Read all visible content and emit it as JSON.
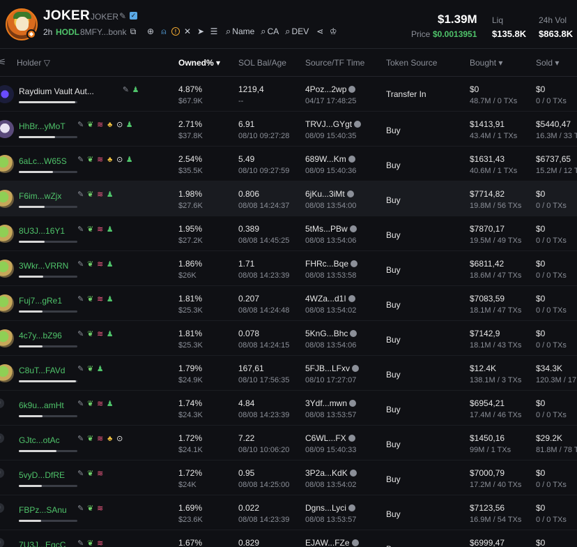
{
  "token": {
    "name": "JOKER",
    "symbol": "JOKER",
    "age": "2h",
    "hodl_label": "HODL",
    "ca_short": "8MFY...bonk",
    "search_name": "Name",
    "search_ca": "CA",
    "search_dev": "DEV"
  },
  "stats": {
    "market_cap": "$1.39M",
    "price_label": "Price",
    "price": "$0.0013951",
    "liq_label": "Liq",
    "liq": "$135.8K",
    "vol_label": "24h Vol",
    "vol": "$863.8K"
  },
  "columns": {
    "holder": "Holder",
    "owned": "Owned% ▾",
    "sol_bal": "SOL Bal/Age",
    "source_time": "Source/TF Time",
    "token_source": "Token Source",
    "bought": "Bought ▾",
    "sold": "Sold ▾"
  },
  "colors": {
    "accent_green": "#4fc36a",
    "background": "#0f1014",
    "muted": "#8b8f98"
  },
  "rows": [
    {
      "name": "Raydium Vault Aut...",
      "name_color": "white",
      "tags": [
        "person"
      ],
      "bar": 0.97,
      "owned": "4.87%",
      "owned_usd": "$67.9K",
      "sol": "1219,4",
      "age": "--",
      "source": "4Poz...2wp",
      "time": "04/17 17:48:25",
      "token_source": "Transfer In",
      "bought": "$0",
      "bought_sub": "48.7M / 0 TXs",
      "sold": "$0",
      "sold_sub": "0 / 0 TXs",
      "avatar": "raydium"
    },
    {
      "name": "HhBr...yMoT",
      "tags": [
        "leaf",
        "stack",
        "group",
        "target",
        "person"
      ],
      "bar": 0.62,
      "owned": "2.71%",
      "owned_usd": "$37.8K",
      "sol": "6.91",
      "age": "08/10 09:27:28",
      "source": "TRVJ...GYgt",
      "time": "08/09 15:40:35",
      "token_source": "Buy",
      "bought": "$1413,91",
      "bought_sub": "43.4M / 1 TXs",
      "sold": "$5440,47",
      "sold_sub": "16.3M / 33 TXs",
      "avatar": "skull"
    },
    {
      "name": "6aLc...W65S",
      "tags": [
        "leaf",
        "stack",
        "group",
        "target",
        "person"
      ],
      "bar": 0.58,
      "owned": "2.54%",
      "owned_usd": "$35.5K",
      "sol": "5.49",
      "age": "08/10 09:27:59",
      "source": "689W...Km",
      "time": "08/09 15:40:36",
      "token_source": "Buy",
      "bought": "$1631,43",
      "bought_sub": "40.6M / 1 TXs",
      "sold": "$6737,65",
      "sold_sub": "15.2M / 12 TXs",
      "avatar": "pepe"
    },
    {
      "name": "F6im...wZjx",
      "tags": [
        "leaf",
        "stack",
        "person"
      ],
      "bar": 0.44,
      "owned": "1.98%",
      "owned_usd": "$27.6K",
      "sol": "0.806",
      "age": "08/08 14:24:37",
      "source": "6jKu...3iMt",
      "time": "08/08 13:54:00",
      "token_source": "Buy",
      "bought": "$7714,82",
      "bought_sub": "19.8M / 56 TXs",
      "sold": "$0",
      "sold_sub": "0 / 0 TXs",
      "avatar": "pepe",
      "highlight": true
    },
    {
      "name": "8U3J...16Y1",
      "tags": [
        "leaf",
        "stack",
        "person"
      ],
      "bar": 0.44,
      "owned": "1.95%",
      "owned_usd": "$27.2K",
      "sol": "0.389",
      "age": "08/08 14:45:25",
      "source": "5tMs...PBw",
      "time": "08/08 13:54:06",
      "token_source": "Buy",
      "bought": "$7870,17",
      "bought_sub": "19.5M / 49 TXs",
      "sold": "$0",
      "sold_sub": "0 / 0 TXs",
      "avatar": "pepe"
    },
    {
      "name": "3Wkr...VRRN",
      "tags": [
        "leaf",
        "stack",
        "person"
      ],
      "bar": 0.42,
      "owned": "1.86%",
      "owned_usd": "$26K",
      "sol": "1.71",
      "age": "08/08 14:23:39",
      "source": "FHRc...Bqe",
      "time": "08/08 13:53:58",
      "token_source": "Buy",
      "bought": "$6811,42",
      "bought_sub": "18.6M / 47 TXs",
      "sold": "$0",
      "sold_sub": "0 / 0 TXs",
      "avatar": "pepe"
    },
    {
      "name": "Fuj7...gRe1",
      "tags": [
        "leaf",
        "stack",
        "person"
      ],
      "bar": 0.41,
      "owned": "1.81%",
      "owned_usd": "$25.3K",
      "sol": "0.207",
      "age": "08/08 14:24:48",
      "source": "4WZa...d1I",
      "time": "08/08 13:54:02",
      "token_source": "Buy",
      "bought": "$7083,59",
      "bought_sub": "18.1M / 47 TXs",
      "sold": "$0",
      "sold_sub": "0 / 0 TXs",
      "avatar": "pepe"
    },
    {
      "name": "4c7y...bZ96",
      "tags": [
        "leaf",
        "stack",
        "person"
      ],
      "bar": 0.41,
      "owned": "1.81%",
      "owned_usd": "$25.3K",
      "sol": "0.078",
      "age": "08/08 14:24:15",
      "source": "5KnG...Bhc",
      "time": "08/08 13:54:06",
      "token_source": "Buy",
      "bought": "$7142,9",
      "bought_sub": "18.1M / 43 TXs",
      "sold": "$0",
      "sold_sub": "0 / 0 TXs",
      "avatar": "pepe"
    },
    {
      "name": "C8uT...FAVd",
      "tags": [
        "leaf",
        "person"
      ],
      "bar": 0.98,
      "owned": "1.79%",
      "owned_usd": "$24.9K",
      "sol": "167,61",
      "age": "08/10 17:56:35",
      "source": "5FJB...LFxv",
      "time": "08/10 17:27:07",
      "token_source": "Buy",
      "bought": "$12.4K",
      "bought_sub": "138.1M / 3 TXs",
      "sold": "$34.3K",
      "sold_sub": "120.3M / 17 TXs",
      "avatar": "pepe"
    },
    {
      "name": "6k9u...amHt",
      "tags": [
        "leaf",
        "stack",
        "person"
      ],
      "bar": 0.4,
      "owned": "1.74%",
      "owned_usd": "$24.3K",
      "sol": "4.84",
      "age": "08/08 14:23:39",
      "source": "3Ydf...mwn",
      "time": "08/08 13:53:57",
      "token_source": "Buy",
      "bought": "$6954,21",
      "bought_sub": "17.4M / 46 TXs",
      "sold": "$0",
      "sold_sub": "0 / 0 TXs",
      "avatar": "small"
    },
    {
      "name": "GJtc...otAc",
      "tags": [
        "edit",
        "leaf",
        "stack",
        "group",
        "target"
      ],
      "bar": 0.64,
      "owned": "1.72%",
      "owned_usd": "$24.1K",
      "sol": "7.22",
      "age": "08/10 10:06:20",
      "source": "C6WL...FX",
      "time": "08/09 15:40:33",
      "token_source": "Buy",
      "bought": "$1450,16",
      "bought_sub": "99M / 1 TXs",
      "sold": "$29.2K",
      "sold_sub": "81.8M / 78 TXs",
      "avatar": "small"
    },
    {
      "name": "5vyD...DfRE",
      "tags": [
        "leaf",
        "stack"
      ],
      "bar": 0.39,
      "owned": "1.72%",
      "owned_usd": "$24K",
      "sol": "0.95",
      "age": "08/08 14:25:00",
      "source": "3P2a...KdK",
      "time": "08/08 13:54:02",
      "token_source": "Buy",
      "bought": "$7000,79",
      "bought_sub": "17.2M / 40 TXs",
      "sold": "$0",
      "sold_sub": "0 / 0 TXs",
      "avatar": "small"
    },
    {
      "name": "FBPz...SAnu",
      "tags": [
        "leaf",
        "stack"
      ],
      "bar": 0.38,
      "owned": "1.69%",
      "owned_usd": "$23.6K",
      "sol": "0.022",
      "age": "08/08 14:23:39",
      "source": "Dgns...Lyci",
      "time": "08/08 13:53:57",
      "token_source": "Buy",
      "bought": "$7123,56",
      "bought_sub": "16.9M / 54 TXs",
      "sold": "$0",
      "sold_sub": "0 / 0 TXs",
      "avatar": "small"
    },
    {
      "name": "7U3J...EqcC",
      "tags": [
        "leaf",
        "stack"
      ],
      "bar": 0.38,
      "owned": "1.67%",
      "owned_usd": "",
      "sol": "0.829",
      "age": "",
      "source": "EJAW...FZe",
      "time": "",
      "token_source": "Buy",
      "bought": "$6999,47",
      "bought_sub": "",
      "sold": "$0",
      "sold_sub": "",
      "avatar": "small"
    }
  ]
}
